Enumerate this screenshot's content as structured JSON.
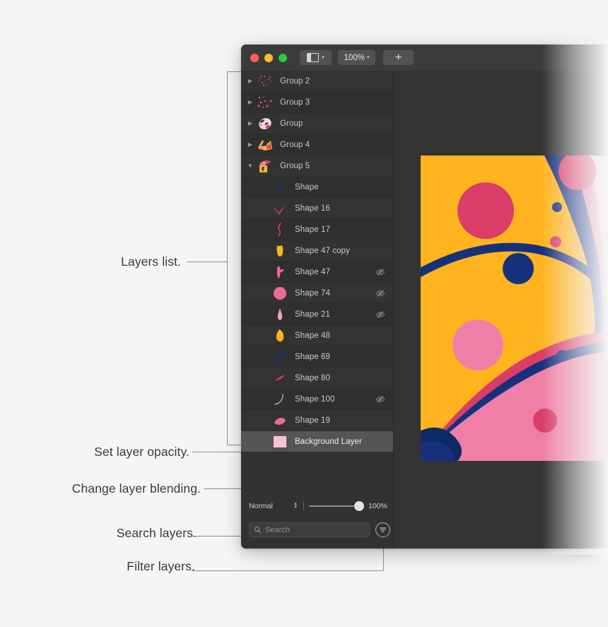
{
  "app": {
    "toolbar": {
      "sidebar_toggle_icon": "sidebar-icon",
      "sidebar_chevron": "▾",
      "zoom_value": "100%",
      "zoom_chevron": "▾",
      "add_label": "+",
      "traffic_lights": [
        "close",
        "minimize",
        "zoom"
      ]
    },
    "layers_panel": {
      "rows": [
        {
          "name": "Group 2",
          "disclosure": "collapsed",
          "indent": 0,
          "hidden": false,
          "selected": false,
          "thumb": "confetti-sparse"
        },
        {
          "name": "Group 3",
          "disclosure": "collapsed",
          "indent": 0,
          "hidden": false,
          "selected": false,
          "thumb": "confetti-dots"
        },
        {
          "name": "Group",
          "disclosure": "collapsed",
          "indent": 0,
          "hidden": false,
          "selected": false,
          "thumb": "face"
        },
        {
          "name": "Group 4",
          "disclosure": "collapsed",
          "indent": 0,
          "hidden": false,
          "selected": false,
          "thumb": "abstract-yellow"
        },
        {
          "name": "Group 5",
          "disclosure": "expanded",
          "indent": 0,
          "hidden": false,
          "selected": false,
          "thumb": "abstract-pink"
        },
        {
          "name": "Shape",
          "disclosure": "none",
          "indent": 1,
          "hidden": false,
          "selected": false,
          "thumb": "navy-fork"
        },
        {
          "name": "Shape 16",
          "disclosure": "none",
          "indent": 1,
          "hidden": false,
          "selected": false,
          "thumb": "pink-check"
        },
        {
          "name": "Shape 17",
          "disclosure": "none",
          "indent": 1,
          "hidden": false,
          "selected": false,
          "thumb": "pink-squiggle"
        },
        {
          "name": "Shape 47 copy",
          "disclosure": "none",
          "indent": 1,
          "hidden": false,
          "selected": false,
          "thumb": "yellow-blob"
        },
        {
          "name": "Shape 47",
          "disclosure": "none",
          "indent": 1,
          "hidden": true,
          "selected": false,
          "thumb": "pink-limb"
        },
        {
          "name": "Shape 74",
          "disclosure": "none",
          "indent": 1,
          "hidden": true,
          "selected": false,
          "thumb": "pink-circle"
        },
        {
          "name": "Shape 21",
          "disclosure": "none",
          "indent": 1,
          "hidden": true,
          "selected": false,
          "thumb": "pink-drop"
        },
        {
          "name": "Shape 48",
          "disclosure": "none",
          "indent": 1,
          "hidden": false,
          "selected": false,
          "thumb": "yellow-rock"
        },
        {
          "name": "Shape 69",
          "disclosure": "none",
          "indent": 1,
          "hidden": false,
          "selected": false,
          "thumb": "navy-swoosh"
        },
        {
          "name": "Shape 80",
          "disclosure": "none",
          "indent": 1,
          "hidden": false,
          "selected": false,
          "thumb": "pink-hook"
        },
        {
          "name": "Shape 100",
          "disclosure": "none",
          "indent": 1,
          "hidden": true,
          "selected": false,
          "thumb": "pink-thin-curve"
        },
        {
          "name": "Shape 19",
          "disclosure": "none",
          "indent": 1,
          "hidden": false,
          "selected": false,
          "thumb": "pink-patch"
        },
        {
          "name": "Background Layer",
          "disclosure": "none",
          "indent": 1,
          "hidden": false,
          "selected": true,
          "thumb": "light-pink-swatch"
        }
      ]
    },
    "blend_bar": {
      "blend_mode": "Normal",
      "stepper_icon": "stepper-icon",
      "opacity_value": "100%",
      "opacity_percent": 100
    },
    "search_bar": {
      "search_icon": "search-icon",
      "search_value": "",
      "search_placeholder": "Search",
      "filter_icon": "filter-icon"
    }
  },
  "callouts": [
    {
      "key": "layers_list",
      "label": "Layers list."
    },
    {
      "key": "set_opacity",
      "label": "Set layer opacity."
    },
    {
      "key": "change_blending",
      "label": "Change layer blending."
    },
    {
      "key": "search_layers",
      "label": "Search layers."
    },
    {
      "key": "filter_layers",
      "label": "Filter layers."
    }
  ],
  "colors": {
    "canvas_bg": "#343434",
    "panel_bg": "#323232",
    "toolbar_bg": "#3b3b3b",
    "row_bg": "#333333",
    "row_selected": "#555555",
    "text": "#c9c9c9",
    "callout_text": "#3a3a3a",
    "leader_line": "#8e8e8e",
    "art_yellow": "#ffb41f",
    "art_navy": "#16307e",
    "art_pink": "#ef7fa6",
    "art_magenta": "#d93d68",
    "art_light_pink": "#f7c9d9",
    "page_bg": "#f5f5f5"
  }
}
